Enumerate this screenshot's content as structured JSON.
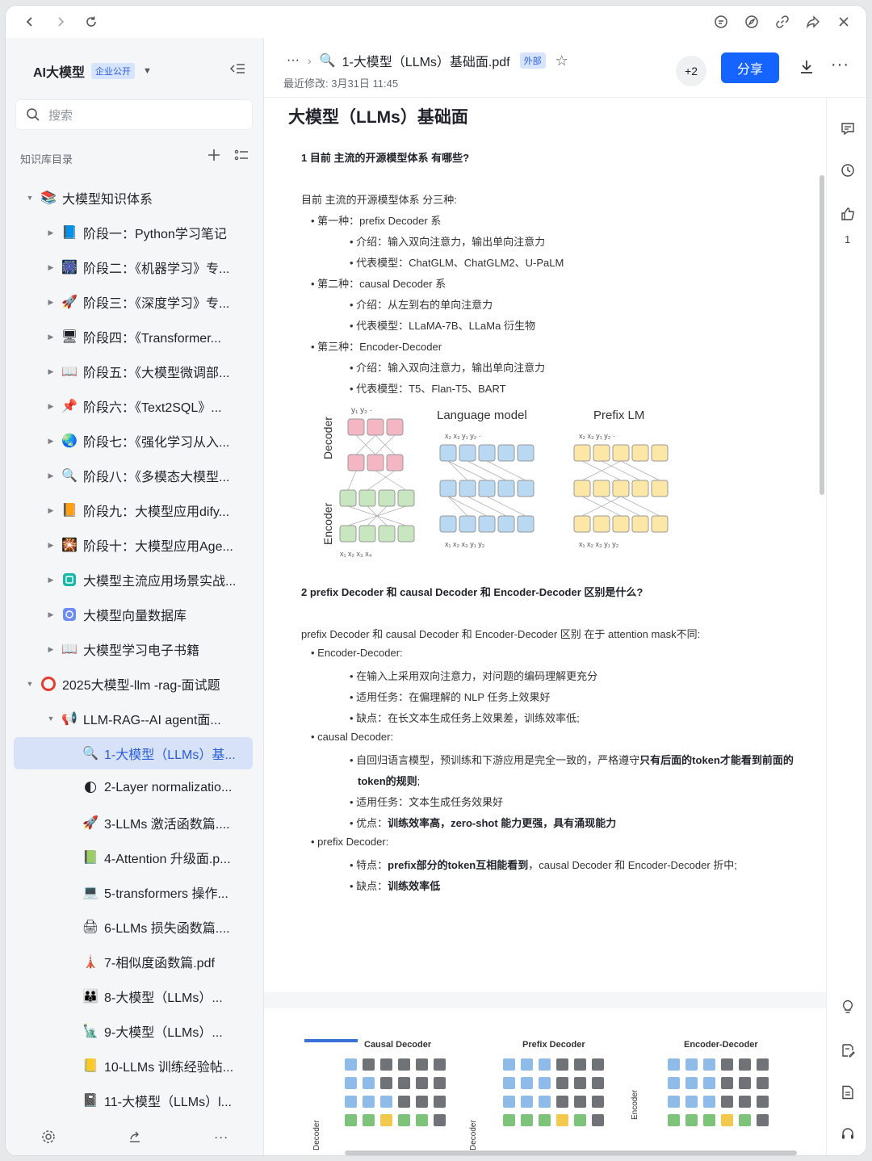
{
  "sidebar": {
    "kb_title": "AI大模型",
    "kb_badge": "企业公开",
    "search_placeholder": "搜索",
    "dir_label": "知识库目录",
    "items": [
      {
        "label": "大模型知识体系",
        "icon": "books-icon"
      },
      {
        "label": "阶段一：Python学习笔记",
        "icon": "blue-book-icon"
      },
      {
        "label": "阶段二：《机器学习》专...",
        "icon": "sparkle-icon"
      },
      {
        "label": "阶段三：《深度学习》专...",
        "icon": "rocket-icon"
      },
      {
        "label": "阶段四：《Transformer...",
        "icon": "computer-icon"
      },
      {
        "label": "阶段五：《大模型微调部...",
        "icon": "open-book-icon"
      },
      {
        "label": "阶段六：《Text2SQL》...",
        "icon": "pushpin-icon"
      },
      {
        "label": "阶段七：《强化学习从入...",
        "icon": "globe-icon"
      },
      {
        "label": "阶段八：《多模态大模型...",
        "icon": "magnifier-icon"
      },
      {
        "label": "阶段九：大模型应用dify...",
        "icon": "orange-book-icon"
      },
      {
        "label": "阶段十：大模型应用Age...",
        "icon": "firework-icon"
      },
      {
        "label": "大模型主流应用场景实战...",
        "icon": "teal-app-icon"
      },
      {
        "label": "大模型向量数据库",
        "icon": "blue-app-icon"
      },
      {
        "label": "大模型学习电子书籍",
        "icon": "open-book-icon"
      },
      {
        "label": "2025大模型-llm -rag-面试题",
        "icon": "red-circle-icon"
      },
      {
        "label": "LLM-RAG--AI agent面...",
        "icon": "megaphone-icon"
      },
      {
        "label": "1-大模型（LLMs）基...",
        "icon": "magnifier-icon"
      },
      {
        "label": "2-Layer normalizatio...",
        "icon": "moon-icon"
      },
      {
        "label": "3-LLMs 激活函数篇....",
        "icon": "rocket-icon"
      },
      {
        "label": "4-Attention 升级面.p...",
        "icon": "green-book-icon"
      },
      {
        "label": "5-transformers 操作...",
        "icon": "computer-icon"
      },
      {
        "label": "6-LLMs 损失函数篇....",
        "icon": "printer-icon"
      },
      {
        "label": "7-相似度函数篇.pdf",
        "icon": "tower-icon"
      },
      {
        "label": "8-大模型（LLMs）...",
        "icon": "family-icon"
      },
      {
        "label": "9-大模型（LLMs）...",
        "icon": "statue-icon"
      },
      {
        "label": "10-LLMs 训练经验帖...",
        "icon": "notepad-icon"
      },
      {
        "label": "11-大模型（LLMs）l...",
        "icon": "notebook-icon"
      }
    ]
  },
  "header": {
    "breadcrumb_more": "···",
    "doc_name": "1-大模型（LLMs）基础面.pdf",
    "external_badge": "外部",
    "modified": "最近修改: 3月31日 11:45",
    "collaborators": "+2",
    "share_label": "分享"
  },
  "document": {
    "title": "大模型（LLMs）基础面",
    "q1": "1 目前 主流的开源模型体系 有哪些?",
    "q1_intro": "目前 主流的开源模型体系 分三种:",
    "l1": "• 第一种：prefix Decoder 系",
    "l2": "• 介绍：输入双向注意力，输出单向注意力",
    "l3": "• 代表模型：ChatGLM、ChatGLM2、U-PaLM",
    "l4": "• 第二种：causal Decoder 系",
    "l5": "• 介绍：从左到右的单向注意力",
    "l6": "• 代表模型：LLaMA-7B、LLaMa 衍生物",
    "l7": "• 第三种：Encoder-Decoder",
    "l8": "• 介绍：输入双向注意力，输出单向注意力",
    "l9": "• 代表模型：T5、Flan-T5、BART",
    "fig_decoder": "Decoder",
    "fig_encoder": "Encoder",
    "fig_lm": "Language model",
    "fig_prefix": "Prefix LM",
    "q2": "2 prefix Decoder 和 causal Decoder 和 Encoder-Decoder 区别是什么?",
    "q2_intro": "prefix Decoder 和 causal Decoder 和 Encoder-Decoder 区别 在于 attention mask不同:",
    "m1": "• Encoder-Decoder:",
    "m2": "• 在输入上采用双向注意力，对问题的编码理解更充分",
    "m3": "• 适用任务：在偏理解的 NLP 任务上效果好",
    "m4": "• 缺点：在长文本生成任务上效果差，训练效率低;",
    "m5": "• causal Decoder:",
    "m6a": "• 自回归语言模型，预训练和下游应用是完全一致的，严格遵守",
    "m6b": "只有后面的token才能看到前面的",
    "m6c": "token的规则",
    "m6d": ";",
    "m7": "• 适用任务：文本生成任务效果好",
    "m8a": "• 优点：",
    "m8b": "训练效率高，zero-shot  能力更强，具有涌现能力",
    "m9": "• prefix Decoder:",
    "m10a": "• 特点：",
    "m10b": "prefix部分的token互相能看到",
    "m10c": "，causal  Decoder  和  Encoder-Decoder  折中;",
    "m11a": "• 缺点：",
    "m11b": "训练效率低",
    "fig2_causal": "Causal Decoder",
    "fig2_prefix": "Prefix Decoder",
    "fig2_encdec": "Encoder-Decoder",
    "fig2_decoder_side": "Decoder",
    "fig2_encoder_side": "Encoder"
  },
  "rail": {
    "like_count": "1"
  },
  "colors": {
    "accent": "#1664ff",
    "active_bg": "#d7e1f7",
    "pink": "#f4b6c2",
    "green": "#c8e6c0",
    "blue": "#b9d8f2",
    "yellow": "#fde7a6"
  }
}
